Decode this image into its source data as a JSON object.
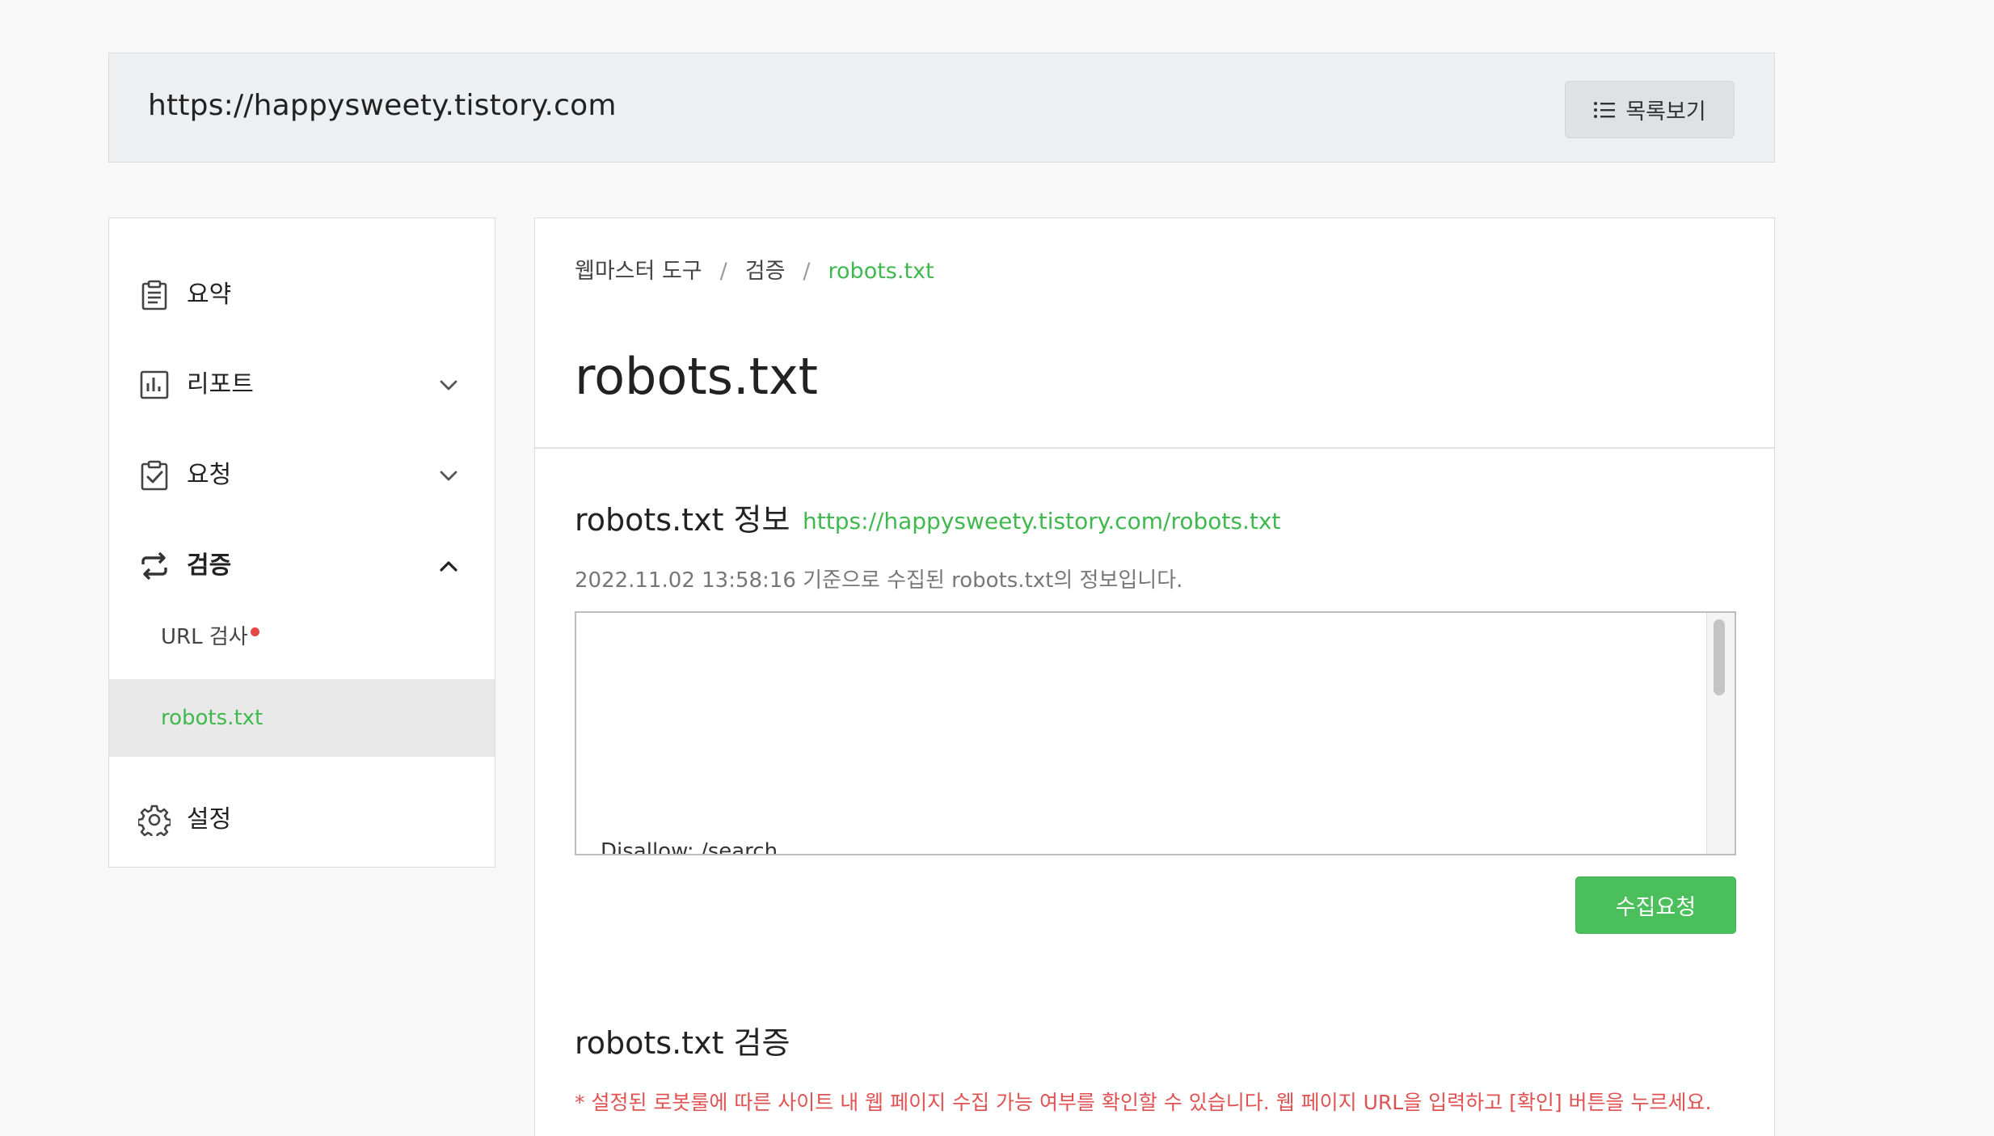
{
  "site": {
    "url": "https://happysweety.tistory.com",
    "list_button_label": "목록보기"
  },
  "sidebar": {
    "items": [
      {
        "label": "요약",
        "icon": "clipboard-list-icon"
      },
      {
        "label": "리포트",
        "icon": "bar-chart-icon",
        "expanded": false
      },
      {
        "label": "요청",
        "icon": "clipboard-check-icon",
        "expanded": false
      },
      {
        "label": "검증",
        "icon": "repeat-icon",
        "expanded": true
      },
      {
        "label": "설정",
        "icon": "gear-icon"
      }
    ],
    "sub_items": [
      {
        "label": "URL 검사",
        "new": true
      },
      {
        "label": "robots.txt",
        "active": true
      }
    ]
  },
  "breadcrumb": [
    "웹마스터 도구",
    "검증",
    "robots.txt"
  ],
  "breadcrumb_sep": "/",
  "main": {
    "title": "robots.txt",
    "info_title": "robots.txt 정보",
    "robots_url": "https://happysweety.tistory.com/robots.txt",
    "collected_note": "2022.11.02 13:58:16 기준으로 수집된 robots.txt의 정보입니다.",
    "robots_content_peek": "Disallow: /search",
    "collect_button_label": "수집요청",
    "verify_title": "robots.txt 검증",
    "verify_note": "* 설정된 로봇룰에 따른 사이트 내 웹 페이지 수집 가능 여부를 확인할 수 있습니다. 웹 페이지 URL을 입력하고 [확인] 버튼을 누르세요."
  },
  "colors": {
    "accent_green": "#3fb84e",
    "button_green": "#4cbf5d",
    "warning_red": "#e05252",
    "new_dot": "#e54848"
  }
}
